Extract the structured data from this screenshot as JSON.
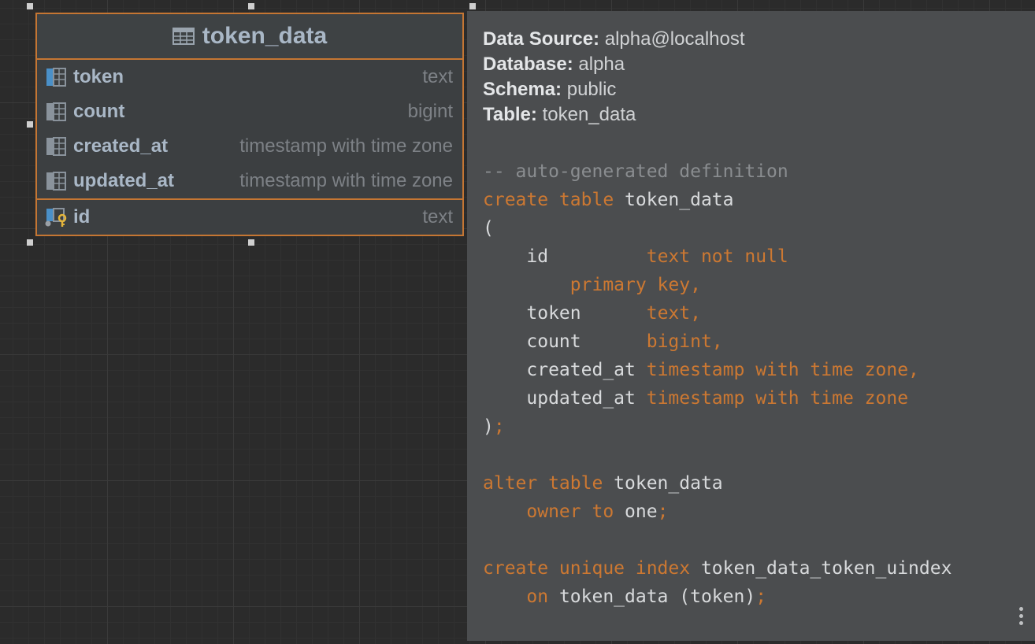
{
  "table": {
    "name": "token_data",
    "columns": [
      {
        "name": "token",
        "type": "text"
      },
      {
        "name": "count",
        "type": "bigint"
      },
      {
        "name": "created_at",
        "type": "timestamp with time zone"
      },
      {
        "name": "updated_at",
        "type": "timestamp with time zone"
      }
    ],
    "key_column": {
      "name": "id",
      "type": "text"
    }
  },
  "popup": {
    "meta": {
      "data_source_label": "Data Source:",
      "data_source": "alpha@localhost",
      "database_label": "Database:",
      "database": "alpha",
      "schema_label": "Schema:",
      "schema": "public",
      "table_label": "Table:",
      "table": "token_data"
    },
    "code_lines": [
      [
        {
          "t": "-- auto-generated definition",
          "c": "cm"
        }
      ],
      [
        {
          "t": "create table ",
          "c": "kw"
        },
        {
          "t": "token_data",
          "c": "id"
        }
      ],
      [
        {
          "t": "(",
          "c": "id"
        }
      ],
      [
        {
          "t": "    id         ",
          "c": "id"
        },
        {
          "t": "text not null",
          "c": "kw"
        }
      ],
      [
        {
          "t": "        primary key,",
          "c": "kw"
        }
      ],
      [
        {
          "t": "    token      ",
          "c": "id"
        },
        {
          "t": "text,",
          "c": "kw"
        }
      ],
      [
        {
          "t": "    count      ",
          "c": "id"
        },
        {
          "t": "bigint,",
          "c": "kw"
        }
      ],
      [
        {
          "t": "    created_at ",
          "c": "id"
        },
        {
          "t": "timestamp with time zone,",
          "c": "kw"
        }
      ],
      [
        {
          "t": "    updated_at ",
          "c": "id"
        },
        {
          "t": "timestamp with time zone",
          "c": "kw"
        }
      ],
      [
        {
          "t": ")",
          "c": "id"
        },
        {
          "t": ";",
          "c": "kw"
        }
      ],
      [],
      [
        {
          "t": "alter table ",
          "c": "kw"
        },
        {
          "t": "token_data",
          "c": "id"
        }
      ],
      [
        {
          "t": "    owner to ",
          "c": "kw"
        },
        {
          "t": "one",
          "c": "id"
        },
        {
          "t": ";",
          "c": "kw"
        }
      ],
      [],
      [
        {
          "t": "create unique index ",
          "c": "kw"
        },
        {
          "t": "token_data_token_uindex",
          "c": "id"
        }
      ],
      [
        {
          "t": "    on ",
          "c": "kw"
        },
        {
          "t": "token_data (token)",
          "c": "id"
        },
        {
          "t": ";",
          "c": "kw"
        }
      ]
    ]
  }
}
